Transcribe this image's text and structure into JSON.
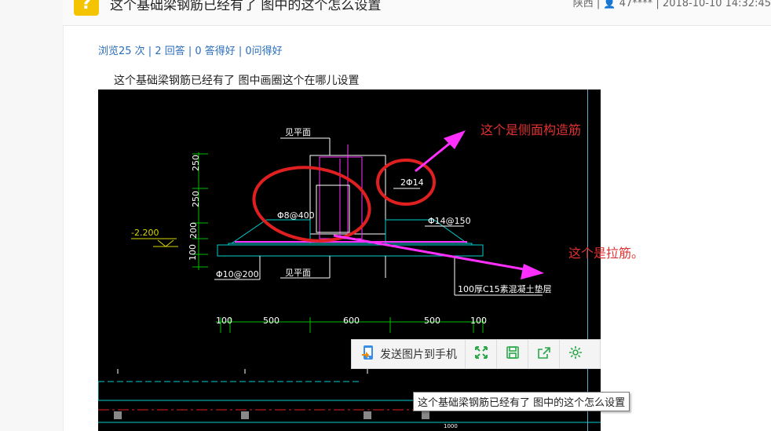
{
  "header": {
    "badge": "?",
    "title": "这个基础梁钢筋已经有了 图中的这个怎么设置",
    "meta": "陕西 | 👤 47**** | 2018-10-10 14:32:45"
  },
  "stats": "浏览25 次 | 2 回答 | 0 答得好 | 0问得好",
  "description": "这个基础梁钢筋已经有了  图中画圈这个在哪儿设置",
  "drawing": {
    "labels": {
      "top_note": "见平面",
      "bottom_note": "见平面",
      "dim_250a": "250",
      "dim_250b": "250",
      "dim_200": "200",
      "dim_100": "100",
      "elev": "-2.200",
      "rebar_side": "2Φ14",
      "rebar_stirrup": "Φ8@400",
      "rebar_tie": "Φ14@150",
      "rebar_bottom": "Φ10@200",
      "cushion": "100厚C15素混凝土垫层",
      "w100a": "100",
      "w500a": "500",
      "w600": "600",
      "w500b": "500",
      "w100b": "100",
      "b1000": "1000"
    },
    "colors": {
      "cyan": "#00d0d0",
      "green": "#00c000",
      "magenta": "#ff30ff",
      "red": "#e02020",
      "yellow": "#d8d800"
    }
  },
  "annotations": {
    "side": "这个是侧面构造筋",
    "tie": "这个是拉筋。"
  },
  "toolbar": {
    "send_label": "发送图片到手机",
    "icons": [
      "fullscreen-icon",
      "save-icon",
      "share-icon",
      "settings-icon"
    ]
  },
  "tooltip": "这个基础梁钢筋已经有了  图中的这个怎么设置"
}
